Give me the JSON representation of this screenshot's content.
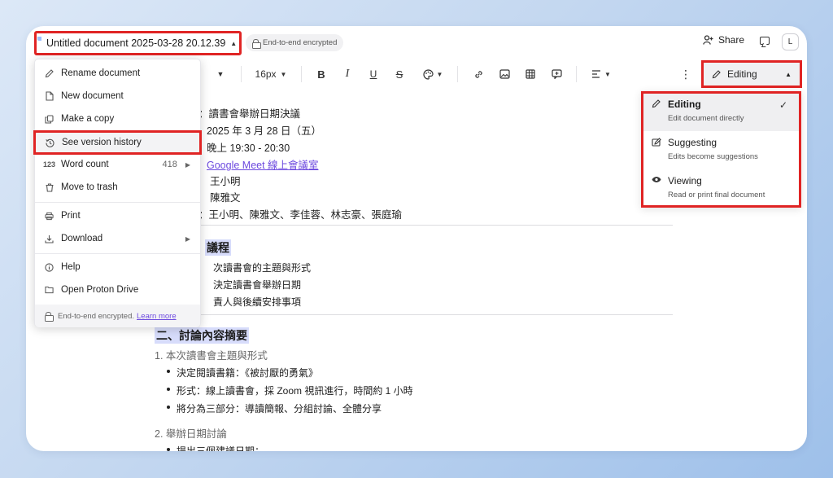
{
  "titlebar": {
    "doc_title": "Untitled document 2025-03-28 20.12.39",
    "encryption_badge": "End-to-end encrypted",
    "share_label": "Share",
    "avatar_initial": "L"
  },
  "toolbar": {
    "font_size": "16px",
    "mode_label": "Editing"
  },
  "menu": {
    "items": [
      {
        "label": "Rename document",
        "icon": "pencil-icon"
      },
      {
        "label": "New document",
        "icon": "file-icon"
      },
      {
        "label": "Make a copy",
        "icon": "copy-icon"
      },
      {
        "label": "See version history",
        "icon": "history-icon"
      },
      {
        "label": "Word count",
        "icon": "word-count-icon",
        "value": "418"
      },
      {
        "label": "Move to trash",
        "icon": "trash-icon"
      },
      {
        "label": "Print",
        "icon": "printer-icon"
      },
      {
        "label": "Download",
        "icon": "download-icon"
      },
      {
        "label": "Help",
        "icon": "help-icon"
      },
      {
        "label": "Open Proton Drive",
        "icon": "folder-icon"
      }
    ],
    "footer_text": "End-to-end encrypted.",
    "footer_link": "Learn more"
  },
  "modes": [
    {
      "title": "Editing",
      "desc": "Edit document directly",
      "icon": "pencil-icon",
      "active": true
    },
    {
      "title": "Suggesting",
      "desc": "Edits become suggestions",
      "icon": "suggest-icon"
    },
    {
      "title": "Viewing",
      "desc": "Read or print final document",
      "icon": "eye-icon"
    }
  ],
  "doc": {
    "meta_lines": [
      "：讀書會舉辦日期決議",
      "2025 年 3 月 28 日（五）",
      "晚上 19:30 - 20:30",
      "Google Meet 線上會議室",
      "王小明",
      "陳雅文",
      "：王小明、陳雅文、李佳蓉、林志豪、張庭瑜"
    ],
    "agenda_heading": "議程",
    "agenda_items": [
      "次讀書會的主題與形式",
      "決定讀書會舉辦日期",
      "責人與後續安排事項"
    ],
    "summary_heading": "二、討論內容摘要",
    "sub1": "1. 本次讀書會主題與形式",
    "bullets1": [
      "決定閱讀書籍：《被討厭的勇氣》",
      "形式：線上讀書會，採 Zoom 視訊進行，時間約 1 小時",
      "將分為三部分：導讀簡報、分組討論、全體分享"
    ],
    "sub2": "2. 舉辦日期討論",
    "bullets2": [
      "提出三個建議日期："
    ]
  },
  "colors": {
    "highlight_red": "#e02424",
    "link_purple": "#6d4adf",
    "heading_bg": "#d7dcfb"
  }
}
